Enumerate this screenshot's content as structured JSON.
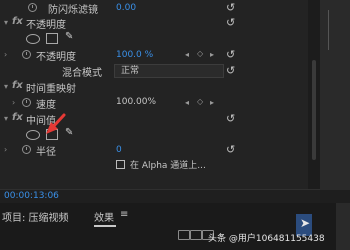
{
  "effects": {
    "flicker_label": "防闪烁滤镜",
    "flicker_value": "0.00",
    "opacity_section": "不透明度",
    "opacity_label": "不透明度",
    "opacity_value": "100.0 %",
    "blend_label": "混合模式",
    "blend_value": "正常",
    "time_remap_section": "时间重映射",
    "speed_label": "速度",
    "speed_value": "100.00%",
    "middle_section": "中间值",
    "radius_label": "半径",
    "radius_value": "0",
    "alpha_label": "在 Alpha 通道上..."
  },
  "timecode": "00:00:13:06",
  "bottom": {
    "project_tab": "项目: 压缩视频",
    "effects_tab": "效果",
    "menu_glyph": "≡"
  },
  "watermark": "头条 @用户106481155438",
  "colors": {
    "accent_blue": "#3a90e8",
    "arrow_red": "#e53935"
  }
}
